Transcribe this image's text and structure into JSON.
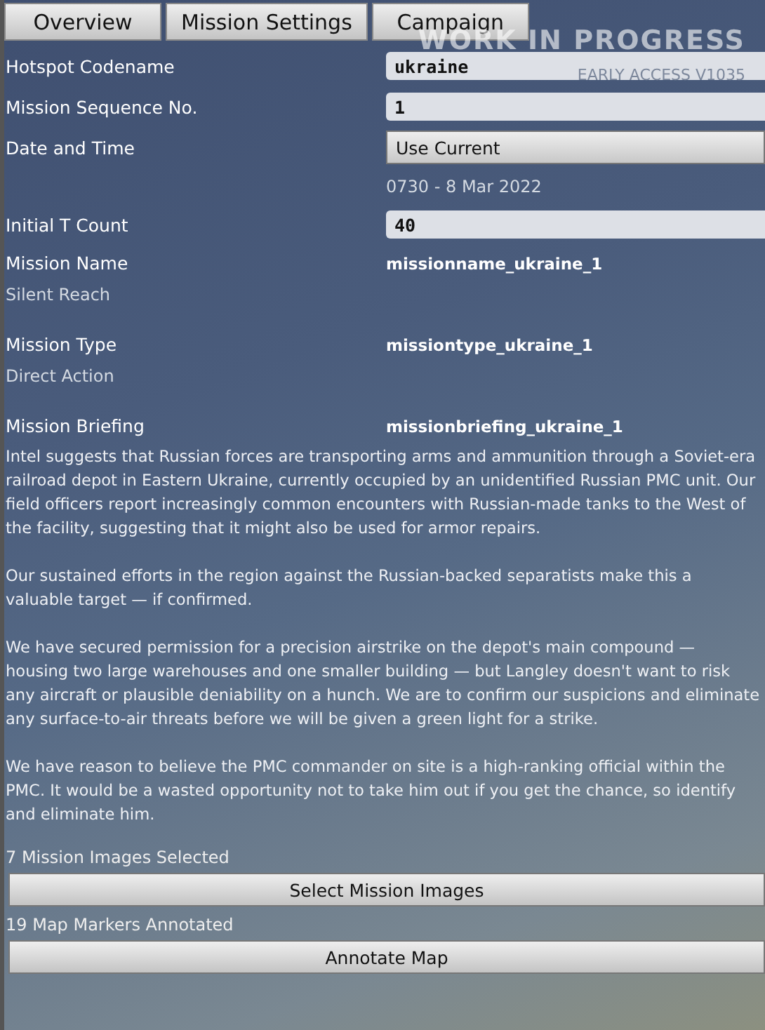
{
  "tabs": [
    {
      "label": "Overview"
    },
    {
      "label": "Mission Settings"
    },
    {
      "label": "Campaign"
    }
  ],
  "overlay": {
    "title": "WORK IN PROGRESS",
    "subtitle": "EARLY ACCESS V1035"
  },
  "fields": [
    {
      "kind": "input",
      "label": "Hotspot Codename",
      "value": "ukraine"
    },
    {
      "kind": "input",
      "label": "Mission Sequence No.",
      "value": "1"
    },
    {
      "kind": "dropdown",
      "label": "Date and Time",
      "value": "Use Current",
      "note": "0730 - 8 Mar 2022"
    },
    {
      "kind": "input",
      "label": "Initial T Count",
      "value": "40"
    },
    {
      "kind": "key",
      "label": "Mission Name",
      "value": "missionname_ukraine_1",
      "note": "Silent Reach"
    },
    {
      "kind": "key",
      "label": "Mission Type",
      "value": "missiontype_ukraine_1",
      "note": "Direct Action"
    },
    {
      "kind": "key",
      "label": "Mission Briefing",
      "value": "missionbriefing_ukraine_1"
    }
  ],
  "briefing": [
    "Intel suggests that Russian forces are transporting arms and ammunition through a Soviet-era railroad depot in Eastern Ukraine, currently occupied by an unidentified Russian PMC unit. Our field officers report increasingly common encounters with Russian-made tanks to the West of the facility, suggesting that it might also be used for armor repairs.",
    "Our sustained efforts in the region against the Russian-backed separatists make this a valuable target — if confirmed.",
    "We have secured permission for a precision airstrike on the depot's main compound — housing two large warehouses and one smaller building — but Langley doesn't want to risk any aircraft or plausible deniability on a hunch. We are to confirm our suspicions and eliminate any surface-to-air threats before we will be given a green light for a strike.",
    "We have reason to believe the PMC commander on site is a high-ranking official within the PMC. It would be a wasted opportunity not to take him out if you get the chance, so identify and eliminate him."
  ],
  "actions": [
    {
      "status": "7 Mission Images Selected",
      "button": "Select Mission Images"
    },
    {
      "status": "19 Map Markers Annotated",
      "button": "Annotate Map"
    }
  ]
}
